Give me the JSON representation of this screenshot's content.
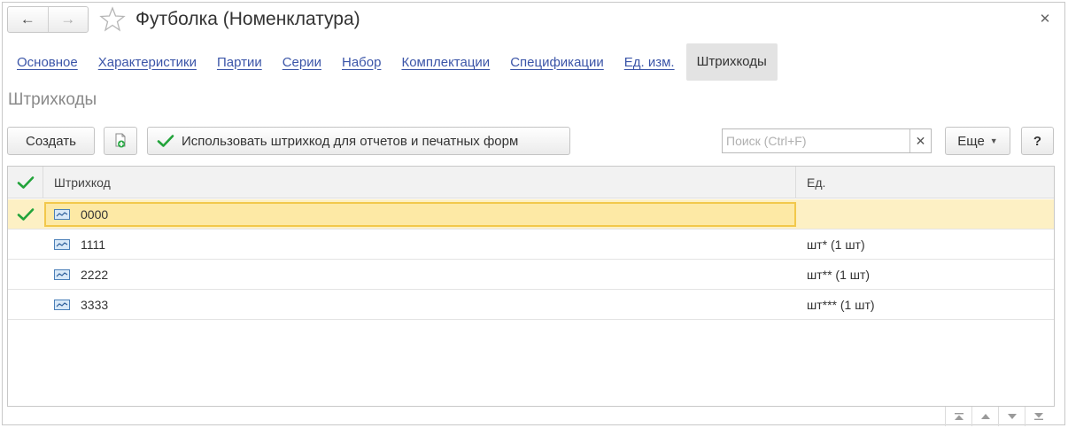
{
  "window": {
    "title": "Футболка (Номенклатура)"
  },
  "nav": {
    "back_icon": "arrow-left-icon",
    "forward_icon": "arrow-right-icon",
    "favorite_icon": "star-icon",
    "close_icon": "close-icon"
  },
  "tabs": [
    {
      "label": "Основное",
      "active": false
    },
    {
      "label": "Характеристики",
      "active": false
    },
    {
      "label": "Партии",
      "active": false
    },
    {
      "label": "Серии",
      "active": false
    },
    {
      "label": "Набор",
      "active": false
    },
    {
      "label": "Комплектации",
      "active": false
    },
    {
      "label": "Спецификации",
      "active": false
    },
    {
      "label": "Ед. изм.",
      "active": false
    },
    {
      "label": "Штрихкоды",
      "active": true
    }
  ],
  "section": {
    "title": "Штрихкоды"
  },
  "toolbar": {
    "create_label": "Создать",
    "copy_icon": "copy-add-icon",
    "use_barcode_label": "Использовать штрихкод для отчетов и печатных форм",
    "search_placeholder": "Поиск (Ctrl+F)",
    "search_clear_icon": "close-icon",
    "more_label": "Еще",
    "help_label": "?"
  },
  "table": {
    "columns": [
      "Штрихкод",
      "Ед."
    ],
    "rows": [
      {
        "checked": true,
        "barcode": "0000",
        "unit": "",
        "selected": true
      },
      {
        "checked": false,
        "barcode": "1111",
        "unit": "шт* (1 шт)",
        "selected": false
      },
      {
        "checked": false,
        "barcode": "2222",
        "unit": "шт** (1 шт)",
        "selected": false
      },
      {
        "checked": false,
        "barcode": "3333",
        "unit": "шт*** (1 шт)",
        "selected": false
      }
    ]
  },
  "colors": {
    "accent_green": "#22a33a",
    "link_blue": "#3b55a8",
    "selection_fill": "#fdf0c4",
    "selection_border": "#f2c84b"
  }
}
